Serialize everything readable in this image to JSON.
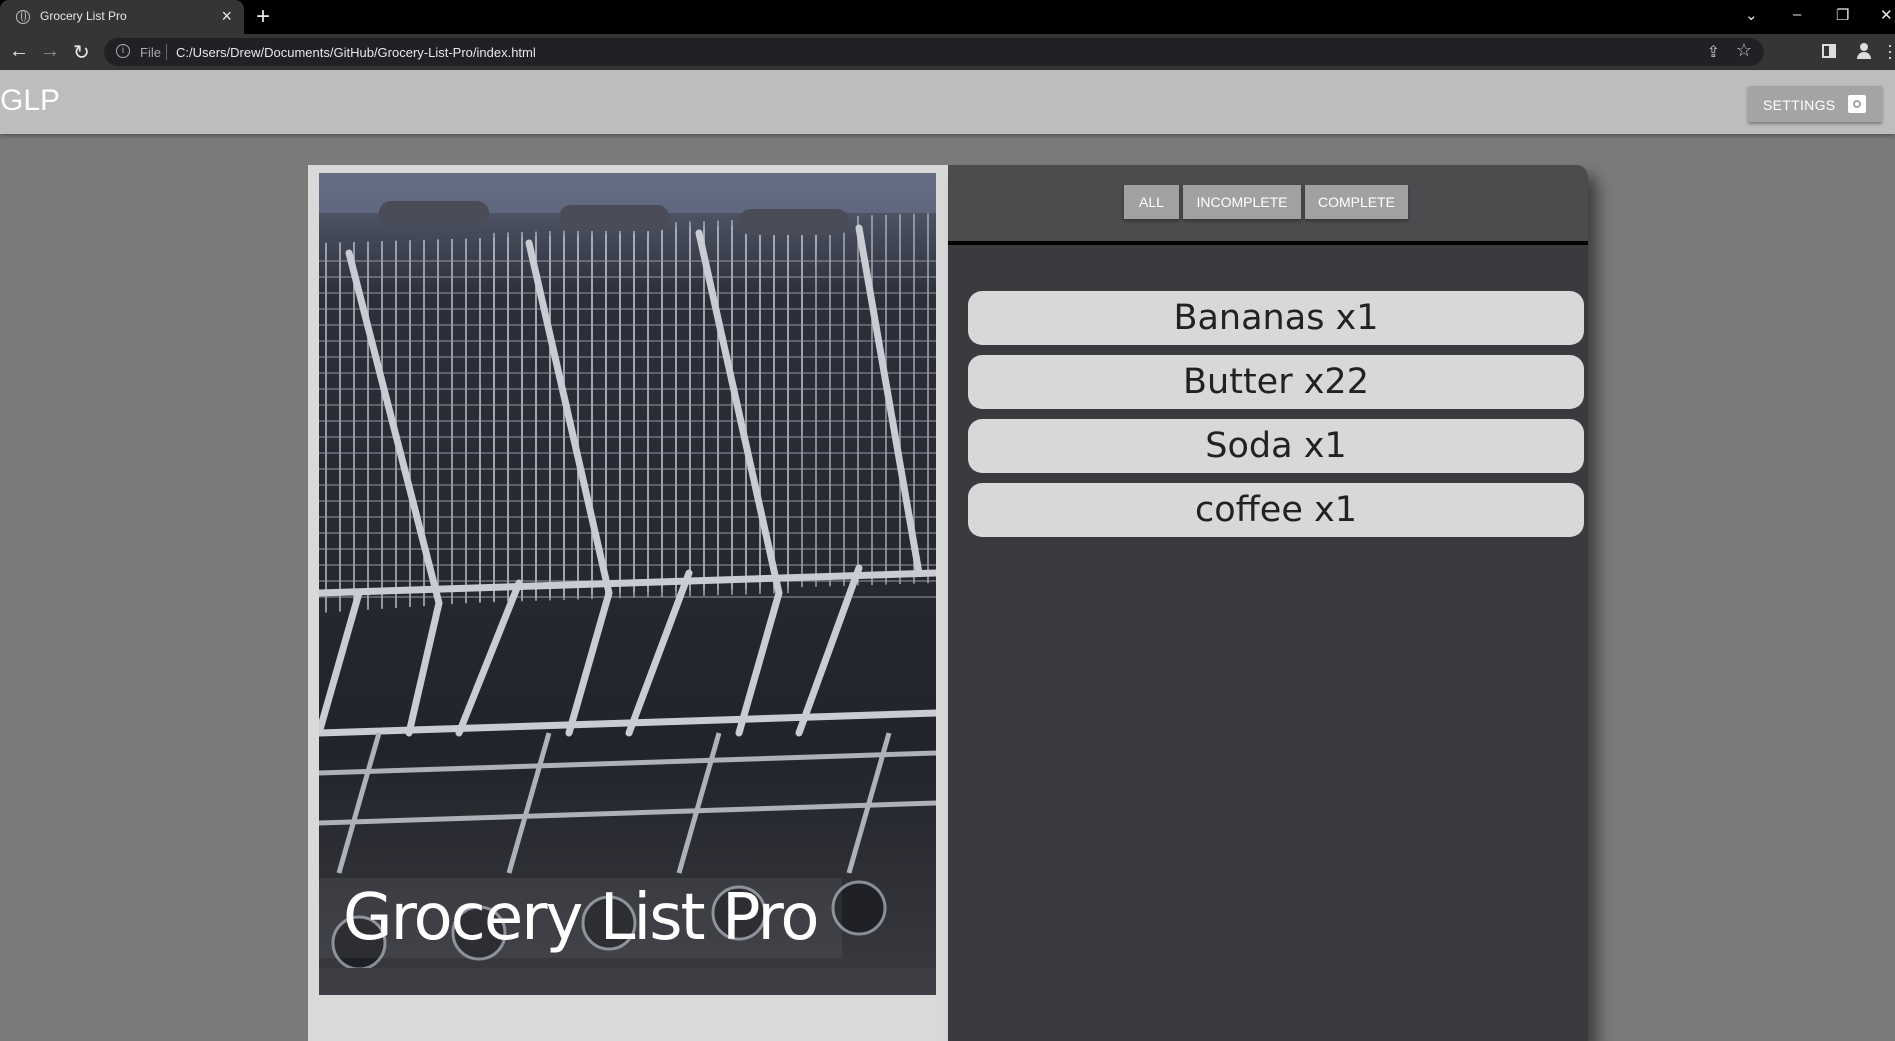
{
  "browser": {
    "tab_title": "Grocery List Pro",
    "tab_close": "×",
    "new_tab": "+",
    "scheme_label": "File",
    "url": "C:/Users/Drew/Documents/GitHub/Grocery-List-Pro/index.html",
    "nav_back": "←",
    "nav_forward": "→",
    "nav_reload": "↻",
    "win_dropdown": "⌄",
    "win_minimize": "–",
    "win_restore": "❐",
    "win_close": "✕"
  },
  "header": {
    "logo": "GLP",
    "settings_label": "SETTINGS"
  },
  "hero": {
    "title": "Grocery List Pro"
  },
  "filters": [
    {
      "label": "ALL"
    },
    {
      "label": "INCOMPLETE"
    },
    {
      "label": "COMPLETE"
    }
  ],
  "items": [
    {
      "label": "Bananas x1"
    },
    {
      "label": "Butter x22"
    },
    {
      "label": "Soda x1"
    },
    {
      "label": "coffee x1"
    }
  ],
  "colors": {
    "page_bg": "#7a7a7a",
    "header_bg": "#bdbdbd",
    "panel_dark": "#3b3b3f",
    "item_bg": "#d8d8d8",
    "button_bg": "#a1a1a1"
  }
}
